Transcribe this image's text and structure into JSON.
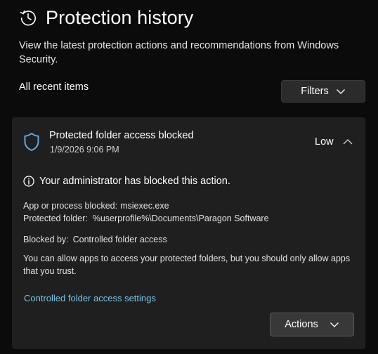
{
  "page": {
    "title": "Protection history",
    "description": "View the latest protection actions and recommendations from Windows Security.",
    "filter_section_label": "All recent items",
    "filters_button_label": "Filters"
  },
  "item": {
    "title": "Protected folder access blocked",
    "timestamp": "1/9/2026 9:06 PM",
    "severity": "Low",
    "admin_message": "Your administrator has blocked this action.",
    "app_label": "App or process blocked:",
    "app_value": "msiexec.exe",
    "folder_label": "Protected folder:",
    "folder_value": "%userprofile%\\Documents\\Paragon Software",
    "blocked_by_label": "Blocked by:",
    "blocked_by_value": "Controlled folder access",
    "advice": "You can allow apps to access your protected folders, but you should only allow apps that you trust.",
    "settings_link": "Controlled folder access settings",
    "actions_button_label": "Actions"
  },
  "icons": {
    "title_icon": "history-clock-icon",
    "shield_icon": "shield-icon",
    "info_icon": "info-icon",
    "collapse_icon": "chevron-up-icon",
    "dropdown_icon": "chevron-down-icon"
  },
  "colors": {
    "background": "#0b0b0b",
    "card": "#1f1f1f",
    "accent_shield": "#5aa9e6",
    "link": "#76c4e6"
  }
}
